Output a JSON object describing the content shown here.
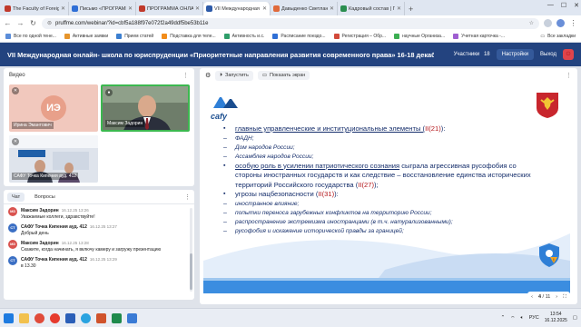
{
  "browser": {
    "tabs": [
      {
        "label": "The Faculty of Foreign Langu",
        "color": "#c0392b",
        "active": false
      },
      {
        "label": "Письмо «ПРОГРАММА Он",
        "color": "#2f6fd6",
        "active": false
      },
      {
        "label": "ПРОГРАММА ОНЛАЙН- Ш",
        "color": "#c0392b",
        "active": false
      },
      {
        "label": "VII Международная он",
        "color": "#2d5aa8",
        "active": true
      },
      {
        "label": "Давыденко Светлана Семёнов",
        "color": "#e06a3b",
        "active": false
      },
      {
        "label": "Кадровый состав | Гомель",
        "color": "#2a8e4f",
        "active": false
      }
    ],
    "url": "pruffme.com/webinar/?id=cbf5a188f97e072f2a49ddf5be53b11e",
    "bookmarks": [
      {
        "label": "Все по одной тене...",
        "color": "#5b8dd9"
      },
      {
        "label": "Активные заявки",
        "color": "#e6952c"
      },
      {
        "label": "Прием статей",
        "color": "#3c7fd0"
      },
      {
        "label": "Подставка для теле...",
        "color": "#f28c1a"
      },
      {
        "label": "Активность и.с.",
        "color": "#2f9e6a"
      },
      {
        "label": "Расписание поездо...",
        "color": "#2f6fd6"
      },
      {
        "label": "Регистрация – Обр...",
        "color": "#d24a3a"
      },
      {
        "label": "научные Организа...",
        "color": "#3cae52"
      },
      {
        "label": "Учетная карточка -...",
        "color": "#9f5fd1"
      }
    ],
    "all_bookmarks": "Все закладки"
  },
  "header": {
    "title": "VII Международная онлайн- школа по юриспруденции «Приоритетные направления развития современного права» 16-18 декабр...",
    "participants_label": "Участники",
    "participants_count": "18",
    "settings_label": "Настройки",
    "exit_label": "Выход"
  },
  "video_panel": {
    "title": "Видео",
    "tiles": [
      {
        "name": "Ирина Эмантович",
        "initials": "ИЭ"
      },
      {
        "name": "Максим Задорин"
      },
      {
        "name": "САФУ Точка Кипения ауд. 412"
      }
    ]
  },
  "chat": {
    "tabs": [
      "Чат",
      "Вопросы"
    ],
    "messages": [
      {
        "avatar": "МЗ",
        "color": "#d9534f",
        "author": "Максим Задорин",
        "time": "16.12.25 13:26",
        "text": "Уважаемые коллеги, здравствуйте!"
      },
      {
        "avatar": "СТ",
        "color": "#3b6fc4",
        "author": "САФУ Точка Кипения ауд. 412",
        "time": "16.12.25 13:27",
        "text": "Добрый день"
      },
      {
        "avatar": "МЗ",
        "color": "#d9534f",
        "author": "Максим Задорин",
        "time": "16.12.25 13:28",
        "text": "Скажите, когда начинать, я включу камеру и загружу презентацию"
      },
      {
        "avatar": "СТ",
        "color": "#3b6fc4",
        "author": "САФУ Точка Кипения ауд. 412",
        "time": "16.12.25 13:29",
        "text": "в 13.30"
      }
    ]
  },
  "presentation": {
    "run_label": "Запустить",
    "show_screen_label": "Показать экран",
    "logo": "cafy",
    "page_current": "4",
    "page_total": "/ 11",
    "slide": {
      "b1_pre": "главные управленческие и институциональные элементы (",
      "b1_num": "II(21)",
      "b1_post": "):",
      "subs1": [
        "ФАДН;",
        "Дом народов России;",
        "Ассамблея народов России;"
      ],
      "b2_lead": "особую роль в усилении патриотического сознания",
      "b2_text": " сыграла агрессивная русофобия со стороны иностранных государств и как следствие – восстановление единства исторических территорий Российского государства (",
      "b2_num": "II(27)",
      "b2_post": ");",
      "b3_pre": "угрозы нацбезопасности (",
      "b3_num": "II(31)",
      "b3_post": "):",
      "subs2": [
        "иностранное влияние;",
        "попытки переноса зарубежных конфликтов на территорию России;",
        "распространение экстремизма иностранцами (в т.ч. натурализованными);",
        "русофобия и искажение исторической правды за границей;"
      ]
    }
  },
  "taskbar": {
    "lang": "РУС",
    "time": "13:54",
    "date": "16.12.2025"
  }
}
